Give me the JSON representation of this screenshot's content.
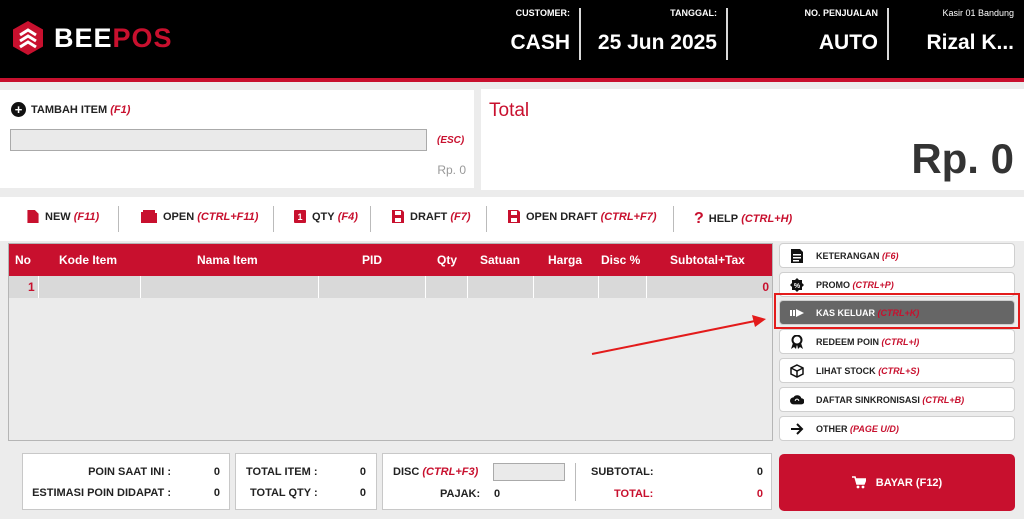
{
  "app": {
    "logo_part1": "BEE",
    "logo_part2": "POS"
  },
  "header": {
    "customer_label": "CUSTOMER:",
    "customer_value": "CASH",
    "tanggal_label": "TANGGAL:",
    "tanggal_value": "25 Jun 2025",
    "penjualan_label": "NO. PENJUALAN",
    "penjualan_value": "AUTO",
    "kasir_label": "Kasir 01 Bandung",
    "kasir_value": "Rizal K..."
  },
  "add_item": {
    "label": "TAMBAH ITEM",
    "shortcut": "(F1)",
    "search_value": "",
    "esc": "(ESC)",
    "price": "Rp. 0"
  },
  "total": {
    "label": "Total",
    "value": "Rp. 0"
  },
  "toolbar": {
    "new_label": "NEW",
    "new_key": "(F11)",
    "open_label": "OPEN",
    "open_key": "(CTRL+F11)",
    "qty_label": "QTY",
    "qty_key": "(F4)",
    "draft_label": "DRAFT",
    "draft_key": "(F7)",
    "open_draft_label": "OPEN DRAFT",
    "open_draft_key": "(CTRL+F7)",
    "help_label": "HELP",
    "help_key": "(CTRL+H)"
  },
  "table": {
    "headers": [
      "No",
      "Kode Item",
      "Nama Item",
      "PID",
      "Qty",
      "Satuan",
      "Harga",
      "Disc %",
      "Subtotal+Tax"
    ],
    "rows": [
      {
        "no": "1",
        "subtotal": "0"
      }
    ]
  },
  "side_buttons": [
    {
      "label": "KETERANGAN",
      "key": "(F6)",
      "icon": "document-icon"
    },
    {
      "label": "PROMO",
      "key": "(CTRL+P)",
      "icon": "promo-badge-icon"
    },
    {
      "label": "KAS KELUAR",
      "key": "(CTRL+K)",
      "icon": "cash-out-arrow-icon"
    },
    {
      "label": "REDEEM POIN",
      "key": "(CTRL+I)",
      "icon": "ribbon-award-icon"
    },
    {
      "label": "LIHAT STOCK",
      "key": "(CTRL+S)",
      "icon": "box-icon"
    },
    {
      "label": "DAFTAR SINKRONISASI",
      "key": "(CTRL+B)",
      "icon": "cloud-sync-icon"
    },
    {
      "label": "OTHER",
      "key": "(PAGE U/D)",
      "icon": "arrow-right-icon"
    }
  ],
  "summary": {
    "poin_saat_ini_label": "POIN SAAT INI :",
    "poin_saat_ini_value": "0",
    "estimasi_poin_label": "ESTIMASI POIN DIDAPAT :",
    "estimasi_poin_value": "0",
    "total_item_label": "TOTAL ITEM :",
    "total_item_value": "0",
    "total_qty_label": "TOTAL QTY :",
    "total_qty_value": "0",
    "disc_label": "DISC",
    "disc_key": "(CTRL+F3)",
    "disc_value": "",
    "pajak_label": "PAJAK:",
    "pajak_value": "0",
    "subtotal_label": "SUBTOTAL:",
    "subtotal_value": "0",
    "total_label": "TOTAL:",
    "total_value": "0"
  },
  "bayar": {
    "label": "BAYAR (F12)"
  },
  "colors": {
    "brand_red": "#c8102e",
    "highlight_red": "#e31b1b",
    "active_grey": "#666666"
  }
}
